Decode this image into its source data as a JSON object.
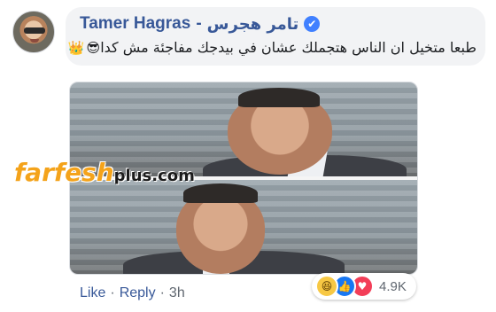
{
  "comment": {
    "author_en": "Tamer Hagras",
    "separator": "-",
    "author_ar": "تامر هجرس",
    "verified_icon": "check-icon",
    "text": "طبعا متخيل ان الناس هتجملك عشان في بيدجك مفاجئة مش كدا",
    "emojis": [
      "😎",
      "👑"
    ]
  },
  "watermark": {
    "brand": "farfesh",
    "suffix": "plus.com"
  },
  "actions": {
    "like": "Like",
    "dot1": "·",
    "reply": "Reply",
    "dot2": "·",
    "time": "3h"
  },
  "reactions": {
    "icons": [
      "haha-icon",
      "like-icon",
      "love-icon"
    ],
    "count": "4.9K"
  },
  "colors": {
    "link": "#385898",
    "bubble": "#f2f3f5",
    "meta": "#606770",
    "watermark_orange": "#f4a31b"
  }
}
